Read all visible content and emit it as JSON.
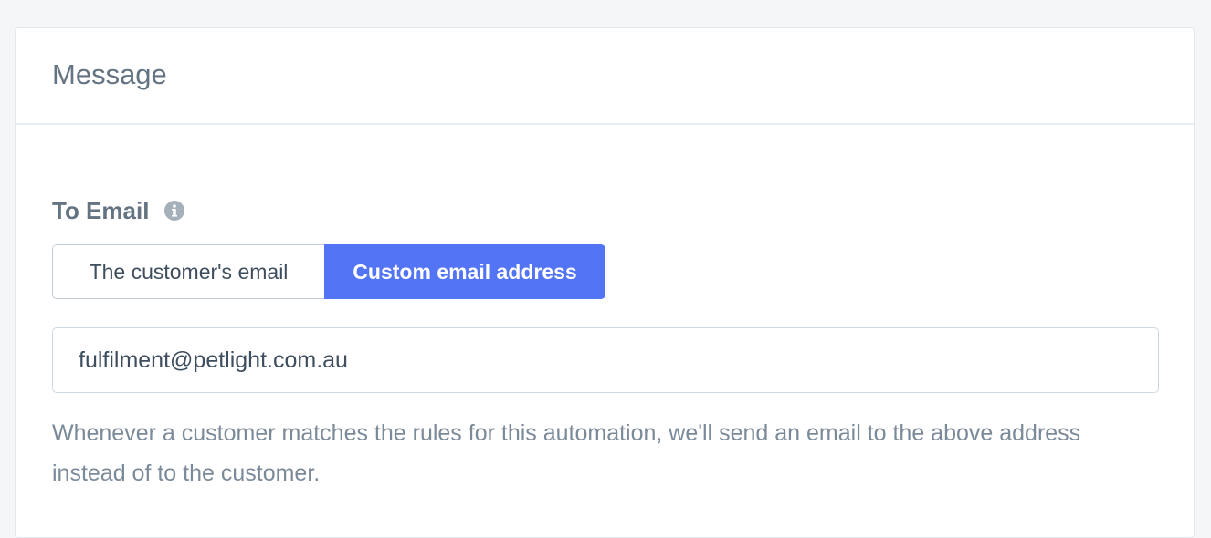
{
  "card": {
    "title": "Message"
  },
  "to_email": {
    "label": "To Email",
    "info_icon": "info-circle-icon",
    "options": [
      {
        "label": "The customer's email",
        "selected": false
      },
      {
        "label": "Custom email address",
        "selected": true
      }
    ],
    "value": "fulfilment@petlight.com.au",
    "help_text": "Whenever a customer matches the rules for this automation, we'll send an email to the above address instead of to the customer."
  },
  "colors": {
    "accent": "#5274f5",
    "text_muted": "#637381",
    "border": "#c4cdd5"
  }
}
